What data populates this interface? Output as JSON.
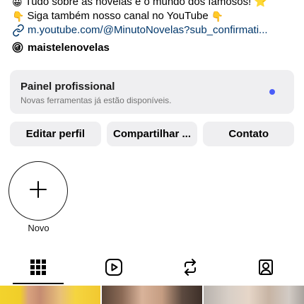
{
  "bio": {
    "line1": "Tudo sobre as novelas e o mundo dos famosos! ⭐",
    "line2": "Siga também nosso canal no YouTube",
    "line2_emoji": "👇",
    "link": "m.youtube.com/@MinutoNovelas?sub_confirmati..."
  },
  "threads": {
    "handle": "maistelenovelas",
    "icon": "threads-icon"
  },
  "professional_panel": {
    "title": "Painel profissional",
    "subtitle": "Novas ferramentas já estão disponíveis.",
    "dot_color": "#4a5df9"
  },
  "actions": {
    "edit_profile": "Editar perfil",
    "share_profile": "Compartilhar ...",
    "contact": "Contato"
  },
  "highlights": {
    "new_label": "Novo",
    "new_icon": "plus-icon"
  },
  "tabs": [
    {
      "name": "posts-grid",
      "icon": "grid-icon",
      "active": true
    },
    {
      "name": "reels",
      "icon": "reels-icon",
      "active": false
    },
    {
      "name": "reposts",
      "icon": "repost-icon",
      "active": false
    },
    {
      "name": "tagged",
      "icon": "tagged-icon",
      "active": false
    }
  ],
  "colors": {
    "link": "#00376b",
    "button_bg": "#efeff1"
  }
}
